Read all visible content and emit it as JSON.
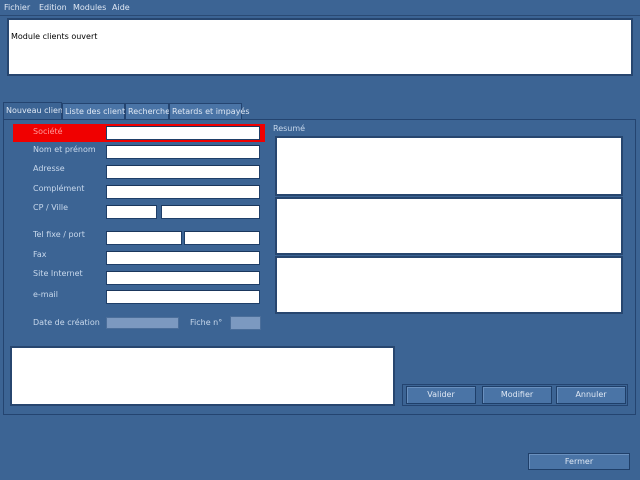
{
  "menu": {
    "items": [
      "Fichier",
      "Edition",
      "Modules",
      "Aide"
    ]
  },
  "log": {
    "message": "Module clients ouvert"
  },
  "tabs": [
    {
      "label": "Nouveau client"
    },
    {
      "label": "Liste des clients"
    },
    {
      "label": "Recherche"
    },
    {
      "label": "Retards et impayés"
    }
  ],
  "form": {
    "societe": "Société",
    "nom": "Nom et prénom",
    "adresse": "Adresse",
    "complement": "Complément",
    "cp_ville": "CP / Ville",
    "tel": "Tel fixe / port",
    "fax": "Fax",
    "site": "Site Internet",
    "email": "e-mail",
    "date_creation": "Date de création",
    "date_value": "",
    "fiche": "Fiche n°"
  },
  "resume": {
    "label": "Resumé"
  },
  "buttons": {
    "valider": "Valider",
    "modifier": "Modifier",
    "annuler": "Annuler",
    "fermer": "Fermer"
  },
  "colors": {
    "background": "#3c6494",
    "required": "#f00000"
  }
}
